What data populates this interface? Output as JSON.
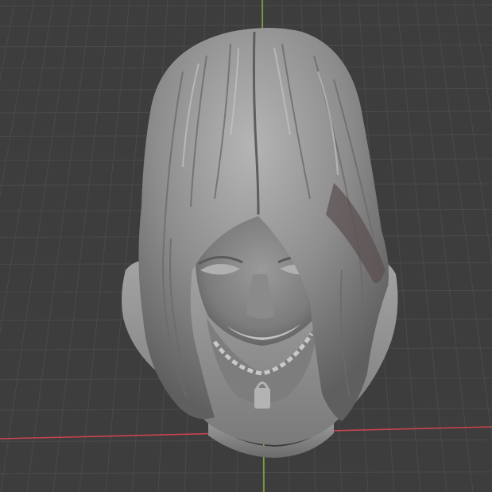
{
  "viewport": {
    "background": "#3d3d3d",
    "grid_color": "#4a4a4a",
    "x_axis_color": "#c8434e",
    "y_axis_color": "#7fa83c"
  },
  "object": {
    "name": "sculpted-bust",
    "material_color": "#8f8f8f",
    "highlight_color": "#b8b8b8",
    "shadow_color": "#5b5b5b"
  }
}
